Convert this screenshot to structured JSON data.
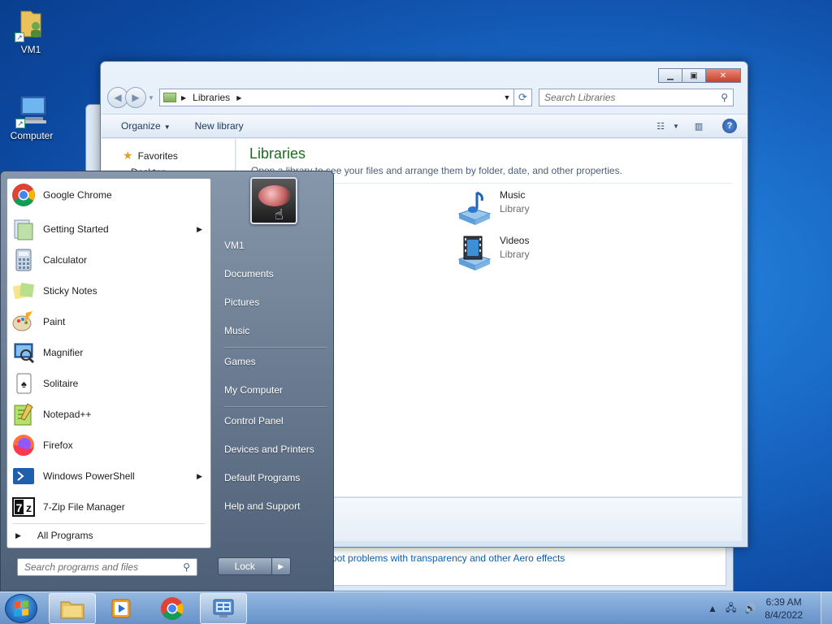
{
  "desktop": {
    "icons": [
      {
        "label": "VM1"
      },
      {
        "label": "Computer"
      }
    ]
  },
  "back_window": {
    "link_text": "oot problems with transparency and other Aero effects"
  },
  "explorer": {
    "address": {
      "crumbs": [
        "Libraries"
      ]
    },
    "search_placeholder": "Search Libraries",
    "toolbar": {
      "organize": "Organize",
      "new_library": "New library"
    },
    "nav_pane": {
      "favorites": "Favorites",
      "desktop_fragment": "Desktop"
    },
    "content": {
      "title": "Libraries",
      "subtitle": "Open a library to see your files and arrange them by folder, date, and other properties.",
      "documents_fragment": "ts",
      "libraries": [
        {
          "name": "Music",
          "type": "Library",
          "icon": "music-library-icon"
        },
        {
          "name": "Videos",
          "type": "Library",
          "icon": "videos-library-icon"
        }
      ]
    }
  },
  "start_menu": {
    "programs": [
      {
        "label": "Google Chrome",
        "icon": "chrome-icon",
        "submenu": false
      },
      {
        "label": "Getting Started",
        "icon": "getting-started-icon",
        "submenu": true
      },
      {
        "label": "Calculator",
        "icon": "calculator-icon",
        "submenu": false
      },
      {
        "label": "Sticky Notes",
        "icon": "sticky-notes-icon",
        "submenu": false
      },
      {
        "label": "Paint",
        "icon": "paint-icon",
        "submenu": false
      },
      {
        "label": "Magnifier",
        "icon": "magnifier-icon",
        "submenu": false
      },
      {
        "label": "Solitaire",
        "icon": "solitaire-icon",
        "submenu": false
      },
      {
        "label": "Notepad++",
        "icon": "notepad-plus-plus-icon",
        "submenu": false
      },
      {
        "label": "Firefox",
        "icon": "firefox-icon",
        "submenu": false
      },
      {
        "label": "Windows PowerShell",
        "icon": "powershell-icon",
        "submenu": true
      },
      {
        "label": "7-Zip File Manager",
        "icon": "seven-zip-icon",
        "submenu": false
      }
    ],
    "all_programs": "All Programs",
    "search_placeholder": "Search programs and files",
    "right_items": [
      {
        "label": "VM1"
      },
      {
        "label": "Documents"
      },
      {
        "label": "Pictures"
      },
      {
        "label": "Music"
      },
      {
        "label": "Games"
      },
      {
        "label": "My Computer"
      },
      {
        "label": "Control Panel"
      },
      {
        "label": "Devices and Printers"
      },
      {
        "label": "Default Programs"
      },
      {
        "label": "Help and Support"
      }
    ],
    "lock_label": "Lock"
  },
  "taskbar": {
    "apps": [
      {
        "name": "windows-explorer-icon"
      },
      {
        "name": "media-player-icon"
      },
      {
        "name": "chrome-icon"
      },
      {
        "name": "control-panel-icon"
      }
    ],
    "clock": {
      "time": "6:39 AM",
      "date": "8/4/2022"
    }
  }
}
